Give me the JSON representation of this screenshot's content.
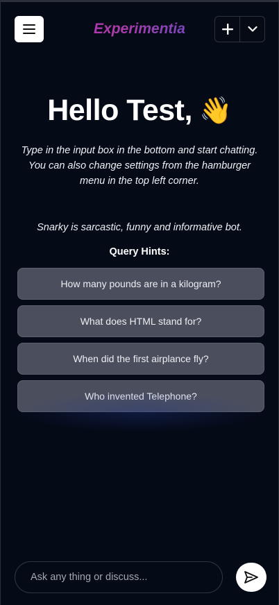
{
  "header": {
    "brand": "Experimentia",
    "menu_icon": "hamburger-menu-icon",
    "new_chat_icon": "plus-icon",
    "dropdown_icon": "chevron-down-icon"
  },
  "hero": {
    "greeting": "Hello Test,",
    "wave": "👋",
    "intro": "Type in the input box in the bottom and start chatting. You can also change settings from the hamburger menu in the top left corner."
  },
  "bot": {
    "description": "Snarky is sarcastic, funny and informative bot."
  },
  "hints": {
    "title": "Query Hints:",
    "items": [
      "How many pounds are in a kilogram?",
      "What does HTML stand for?",
      "When did the first airplance fly?",
      "Who invented Telephone?"
    ]
  },
  "composer": {
    "placeholder": "Ask any thing or discuss...",
    "send_icon": "send-icon"
  },
  "colors": {
    "background": "#050a17",
    "hint_bg": "#4b4f5d",
    "brand_start": "#9b2ad6",
    "brand_end": "#3b56d8"
  }
}
